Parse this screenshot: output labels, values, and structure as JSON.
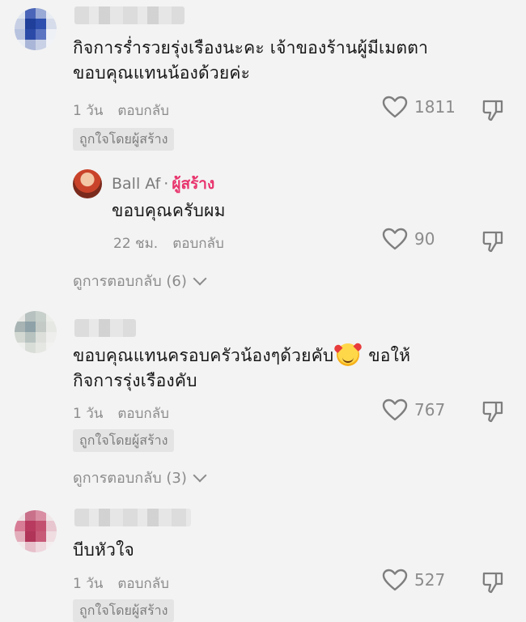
{
  "comments": [
    {
      "text": "กิจการร่ำรวยรุ่งเรืองนะคะ เจ้าของร้านผู้มีเมตตา ขอบคุณแทนน้องด้วยค่ะ",
      "time": "1 วัน",
      "reply_label": "ตอบกลับ",
      "likes": "1811",
      "badge": "ถูกใจโดยผู้สร้าง",
      "view_replies": "ดูการตอบกลับ (6)",
      "avatar_colors": [
        "#dfe6f0",
        "#4b66b8",
        "#9aaad6",
        "#e8ecf3",
        "#c7cfe5",
        "#1f3f9a",
        "#2e4fae",
        "#d6dcea",
        "#b7c2df",
        "#2b4aa8",
        "#5c75c2",
        "#eef1f6",
        "#e9edf4",
        "#aab6d8",
        "#c9d1e6",
        "#f1f3f8"
      ]
    },
    {
      "text_before_emoji": "ขอบคุณแทนครอบครัวน้องๆด้วยคับ",
      "text_after_emoji": " ขอให้กิจการรุ่งเรืองคับ",
      "emoji": "smiling-face-with-hearts",
      "time": "1 วัน",
      "reply_label": "ตอบกลับ",
      "likes": "767",
      "badge": "ถูกใจโดยผู้สร้าง",
      "view_replies": "ดูการตอบกลับ (3)",
      "avatar_colors": [
        "#e8e9e6",
        "#b7c1bf",
        "#c8d0cb",
        "#eceeea",
        "#a7b4b3",
        "#8fa2a8",
        "#c4cbc6",
        "#e6e8e4",
        "#d3d8d2",
        "#b8c3c0",
        "#dcdfda",
        "#eeeeec",
        "#eef0ed",
        "#d9ddd8",
        "#e5e7e3",
        "#f2f2f0"
      ]
    },
    {
      "text": "บีบหัวใจ",
      "time": "1 วัน",
      "reply_label": "ตอบกลับ",
      "likes": "527",
      "badge": "ถูกใจโดยผู้สร้าง",
      "avatar_colors": [
        "#f0e3e6",
        "#c9708a",
        "#d98ea3",
        "#f1e6e8",
        "#d87c96",
        "#b83a5e",
        "#c4506f",
        "#e8c6cf",
        "#e3aebc",
        "#b03458",
        "#c85a78",
        "#efdde2",
        "#f3eaec",
        "#e6bfca",
        "#efd7de",
        "#f5eef0"
      ]
    }
  ],
  "reply": {
    "author": "Ball Af",
    "dot": " · ",
    "creator_label": "ผู้สร้าง",
    "text": "ขอบคุณครับผม",
    "time": "22 ชม.",
    "reply_label": "ตอบกลับ",
    "likes": "90"
  }
}
